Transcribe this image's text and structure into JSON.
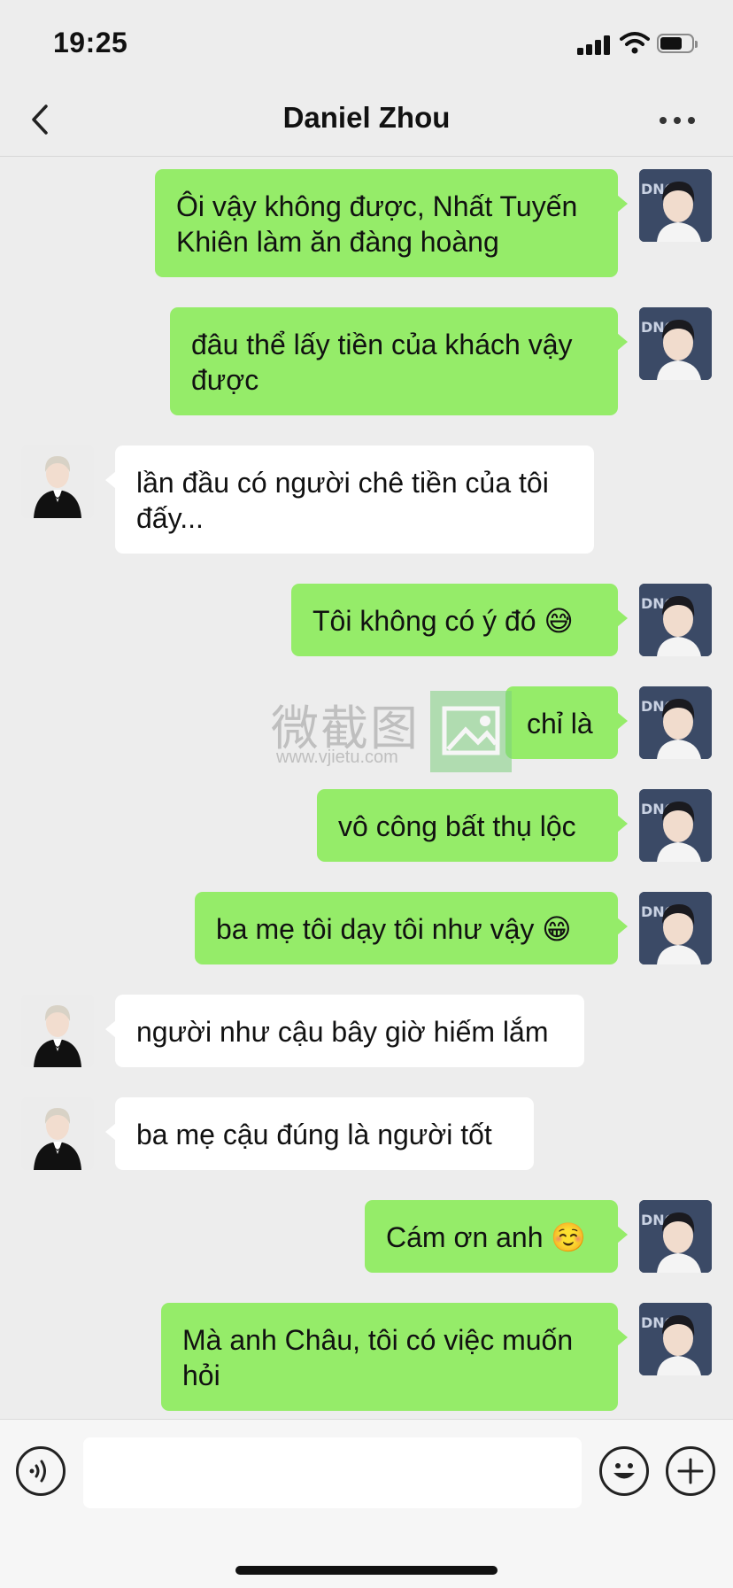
{
  "status_bar": {
    "time": "19:25"
  },
  "nav": {
    "title": "Daniel Zhou"
  },
  "messages": [
    {
      "sender": "me",
      "text": "Ôi vậy không được, Nhất Tuyến Khiên làm ăn đàng hoàng"
    },
    {
      "sender": "me",
      "text": "đâu thể lấy tiền của khách vậy được"
    },
    {
      "sender": "them",
      "text": "lần đầu có người chê tiền của tôi đấy..."
    },
    {
      "sender": "me",
      "text": "Tôi không có ý đó 😅"
    },
    {
      "sender": "me",
      "text": "chỉ là"
    },
    {
      "sender": "me",
      "text": "vô công bất thụ lộc"
    },
    {
      "sender": "me",
      "text": "ba mẹ tôi dạy tôi như vậy 😁"
    },
    {
      "sender": "them",
      "text": "người như cậu bây giờ hiếm lắm"
    },
    {
      "sender": "them",
      "text": "ba mẹ cậu đúng là người tốt"
    },
    {
      "sender": "me",
      "text": "Cám ơn anh ☺️"
    },
    {
      "sender": "me",
      "text": "Mà anh Châu, tôi có việc muốn hỏi"
    }
  ],
  "watermark": {
    "text": "微截图",
    "url": "www.vjietu.com"
  },
  "input_bar": {
    "message_value": ""
  },
  "icons": {
    "back": "chevron-left-icon",
    "more": "more-horizontal-icon",
    "voice": "voice-icon",
    "emoji": "smiley-icon",
    "plus": "plus-icon"
  }
}
